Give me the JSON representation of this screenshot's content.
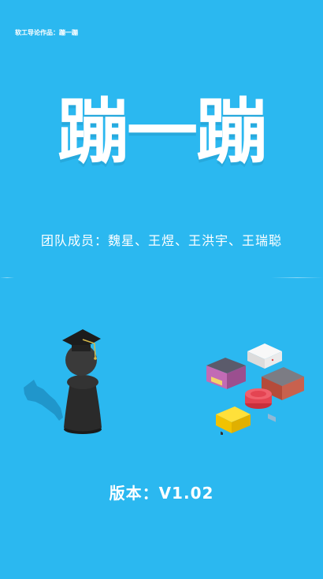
{
  "credit": "软工导论作品：蹦一蹦",
  "title": "蹦一蹦",
  "members": "团队成员：魏星、王煜、王洪宇、王瑞聪",
  "version": "版本：V1.02",
  "colors": {
    "background": "#2bb8f0",
    "text": "#ffffff",
    "player": "#2a2a2a",
    "trail": "#1e8fc4"
  },
  "illustrations": {
    "player": "chess-piece-with-graduation-cap",
    "platforms": [
      "shop-box",
      "white-box",
      "brick-box",
      "red-round-button",
      "yellow-box"
    ]
  }
}
